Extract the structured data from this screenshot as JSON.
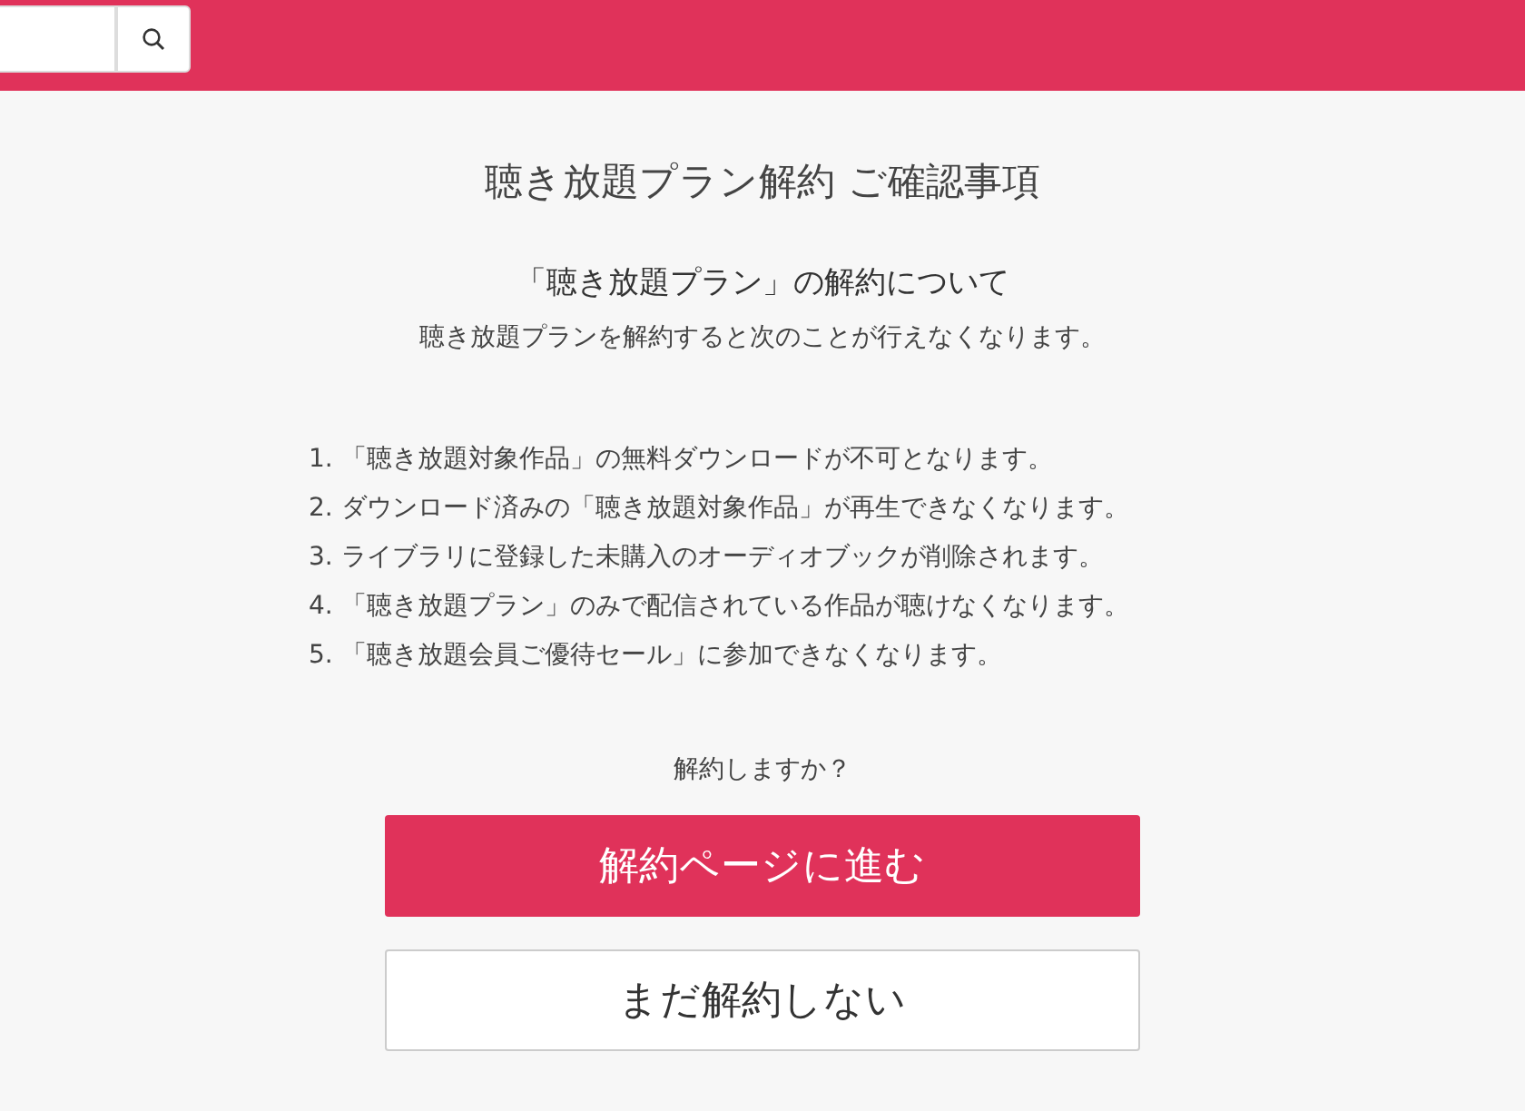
{
  "title": "聴き放題プラン解約 ご確認事項",
  "subtitle": "「聴き放題プラン」の解約について",
  "description": "聴き放題プランを解約すると次のことが行えなくなります。",
  "items": [
    {
      "number": "1.",
      "text": "「聴き放題対象作品」の無料ダウンロードが不可となります。"
    },
    {
      "number": "2.",
      "text": "ダウンロード済みの「聴き放題対象作品」が再生できなくなります。"
    },
    {
      "number": "3.",
      "text": "ライブラリに登録した未購入のオーディオブックが削除されます。"
    },
    {
      "number": "4.",
      "text": "「聴き放題プラン」のみで配信されている作品が聴けなくなります。"
    },
    {
      "number": "5.",
      "text": "「聴き放題会員ご優待セール」に参加できなくなります。"
    }
  ],
  "question": "解約しますか？",
  "buttons": [
    {
      "kind": "primary",
      "label": "解約ページに進む"
    },
    {
      "kind": "secondary",
      "label": "まだ解約しない"
    }
  ]
}
